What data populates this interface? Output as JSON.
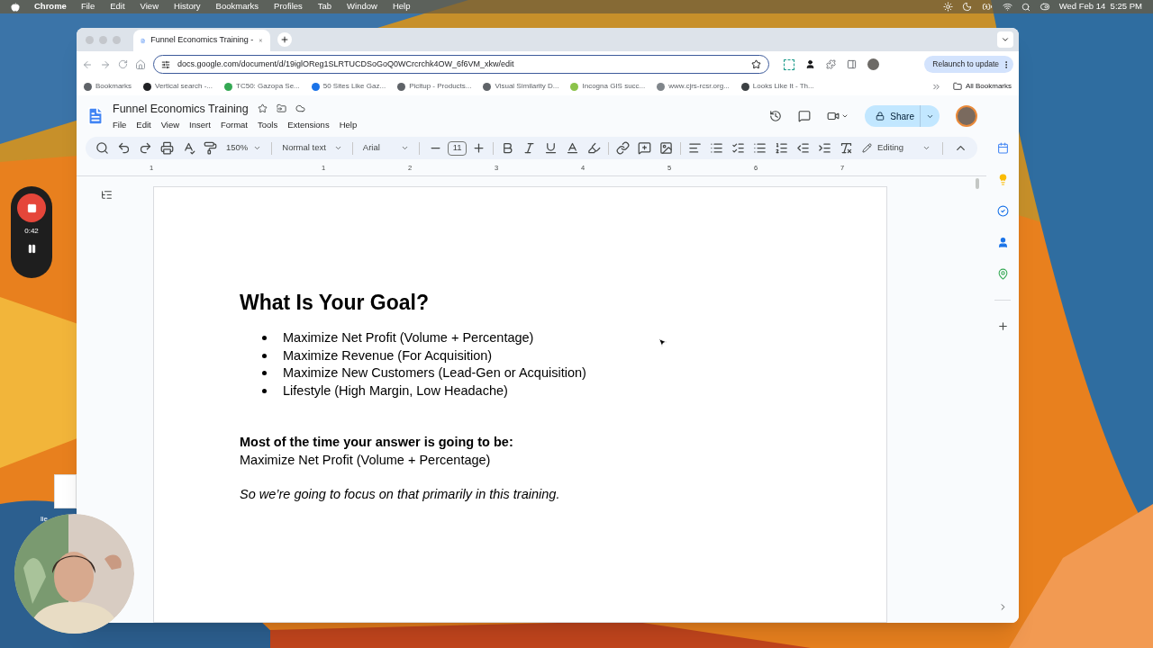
{
  "menubar": {
    "app": "Chrome",
    "menus": [
      "File",
      "Edit",
      "View",
      "History",
      "Bookmarks",
      "Profiles",
      "Tab",
      "Window",
      "Help"
    ],
    "clock": "Wed Feb 14  5:25 PM"
  },
  "browser": {
    "tab": {
      "title": "Funnel Economics Training -",
      "selected": true
    },
    "url": "docs.google.com/document/d/19iglOReg1SLRTUCDSoGoQ0WCrcrchk4OW_6f6VM_xkw/edit",
    "relaunch": "Relaunch to update",
    "bookmarks": [
      {
        "label": "Bookmarks",
        "color": "#5f6368"
      },
      {
        "label": "Vertical search -...",
        "color": "#202124"
      },
      {
        "label": "TC50: Gazopa Se...",
        "color": "#34a853"
      },
      {
        "label": "50 Sites Like Gaz...",
        "color": "#1a73e8"
      },
      {
        "label": "Picitup - Products...",
        "color": "#5f6368"
      },
      {
        "label": "Visual Similarity D...",
        "color": "#5f6368"
      },
      {
        "label": "Incogna GIS succ...",
        "color": "#8bc34a"
      },
      {
        "label": "www.cjrs-rcsr.org...",
        "color": "#80868b"
      },
      {
        "label": "Looks Like It - Th...",
        "color": "#3c4043"
      }
    ],
    "all_bookmarks": "All Bookmarks"
  },
  "docs": {
    "title": "Funnel Economics Training",
    "menus": [
      "File",
      "Edit",
      "View",
      "Insert",
      "Format",
      "Tools",
      "Extensions",
      "Help"
    ],
    "share": "Share",
    "zoom": "150%",
    "style": "Normal text",
    "font": "Arial",
    "font_size": "11",
    "mode": "Editing",
    "ruler": [
      "1",
      "1",
      "2",
      "3",
      "4",
      "5",
      "6",
      "7"
    ]
  },
  "document": {
    "heading": "What Is Your Goal?",
    "bullets": [
      "Maximize Net Profit (Volume + Percentage)",
      "Maximize Revenue (For Acquisition)",
      "Maximize New Customers (Lead-Gen or Acquisition)",
      "Lifestyle (High Margin, Low Headache)"
    ],
    "sections": [
      [
        {
          "text": "Most of the time your answer is going to be:",
          "kind": "bold"
        },
        {
          "text": "Maximize Net Profit (Volume + Percentage)",
          "kind": "plain"
        }
      ],
      [
        {
          "text": "So we’re going to focus on that primarily in this training.",
          "kind": "italic"
        }
      ]
    ]
  },
  "recorder": {
    "time": "0:42"
  },
  "desktop_file": {
    "label": "lie"
  }
}
